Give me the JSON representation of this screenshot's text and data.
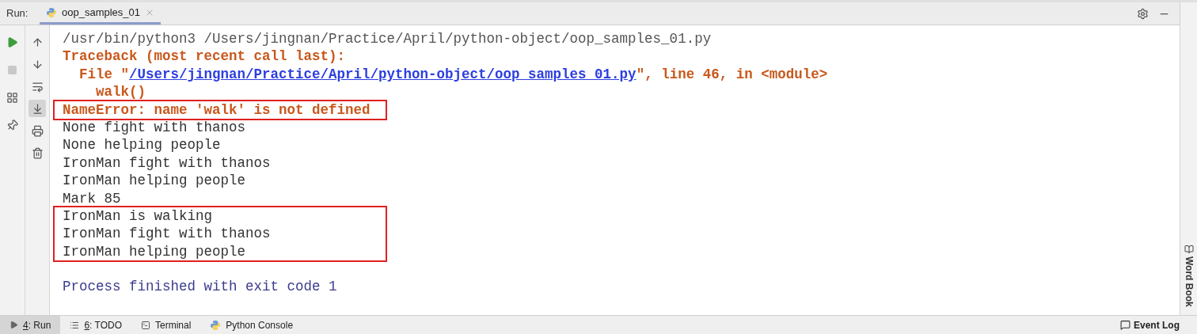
{
  "header": {
    "label": "Run:",
    "tab": {
      "title": "oop_samples_01",
      "selected": true
    }
  },
  "left_toolbar": [
    {
      "kind": "run",
      "disabled": false
    },
    {
      "kind": "stop",
      "disabled": true
    },
    {
      "kind": "layout",
      "disabled": false
    },
    {
      "kind": "pin",
      "disabled": false
    }
  ],
  "right_toolbar": [
    {
      "kind": "up",
      "selected": false
    },
    {
      "kind": "down",
      "selected": false
    },
    {
      "kind": "wrap",
      "selected": false
    },
    {
      "kind": "scroll_end",
      "selected": true
    },
    {
      "kind": "print",
      "selected": false
    },
    {
      "kind": "delete",
      "selected": false
    }
  ],
  "console": [
    {
      "highlighted": false,
      "lines": [
        {
          "kind": "command",
          "text": "/usr/bin/python3 /Users/jingnan/Practice/April/python-object/oop_samples_01.py"
        },
        {
          "kind": "error",
          "text": "Traceback (most recent call last):"
        },
        {
          "kind": "file",
          "prefix": "  File \"",
          "link": "/Users/jingnan/Practice/April/python-object/oop_samples_01.py",
          "suffix": "\", line 46, in <module>"
        },
        {
          "kind": "error",
          "text": "    walk()"
        }
      ]
    },
    {
      "highlighted": true,
      "lines": [
        {
          "kind": "error",
          "text": "NameError: name 'walk' is not defined"
        }
      ]
    },
    {
      "highlighted": false,
      "lines": [
        {
          "kind": "output",
          "text": "None fight with thanos"
        },
        {
          "kind": "output",
          "text": "None helping people"
        },
        {
          "kind": "output",
          "text": "IronMan fight with thanos"
        },
        {
          "kind": "output",
          "text": "IronMan helping people"
        },
        {
          "kind": "output",
          "text": "Mark 85"
        }
      ]
    },
    {
      "highlighted": true,
      "lines": [
        {
          "kind": "output",
          "text": "IronMan is walking"
        },
        {
          "kind": "output",
          "text": "IronMan fight with thanos"
        },
        {
          "kind": "output",
          "text": "IronMan helping people"
        }
      ]
    },
    {
      "highlighted": false,
      "lines": [
        {
          "kind": "exit",
          "text": "Process finished with exit code 1"
        }
      ]
    }
  ],
  "side_panel": {
    "label": "Word Book"
  },
  "bottom_tabs": [
    {
      "kind": "run",
      "key": "4",
      "label": ": Run",
      "selected": true
    },
    {
      "kind": "todo",
      "key": "6",
      "label": ": TODO",
      "selected": false
    },
    {
      "kind": "terminal",
      "label": "Terminal",
      "selected": false
    },
    {
      "kind": "python",
      "label": "Python Console",
      "selected": false
    }
  ],
  "event_log": {
    "label": "Event Log"
  }
}
